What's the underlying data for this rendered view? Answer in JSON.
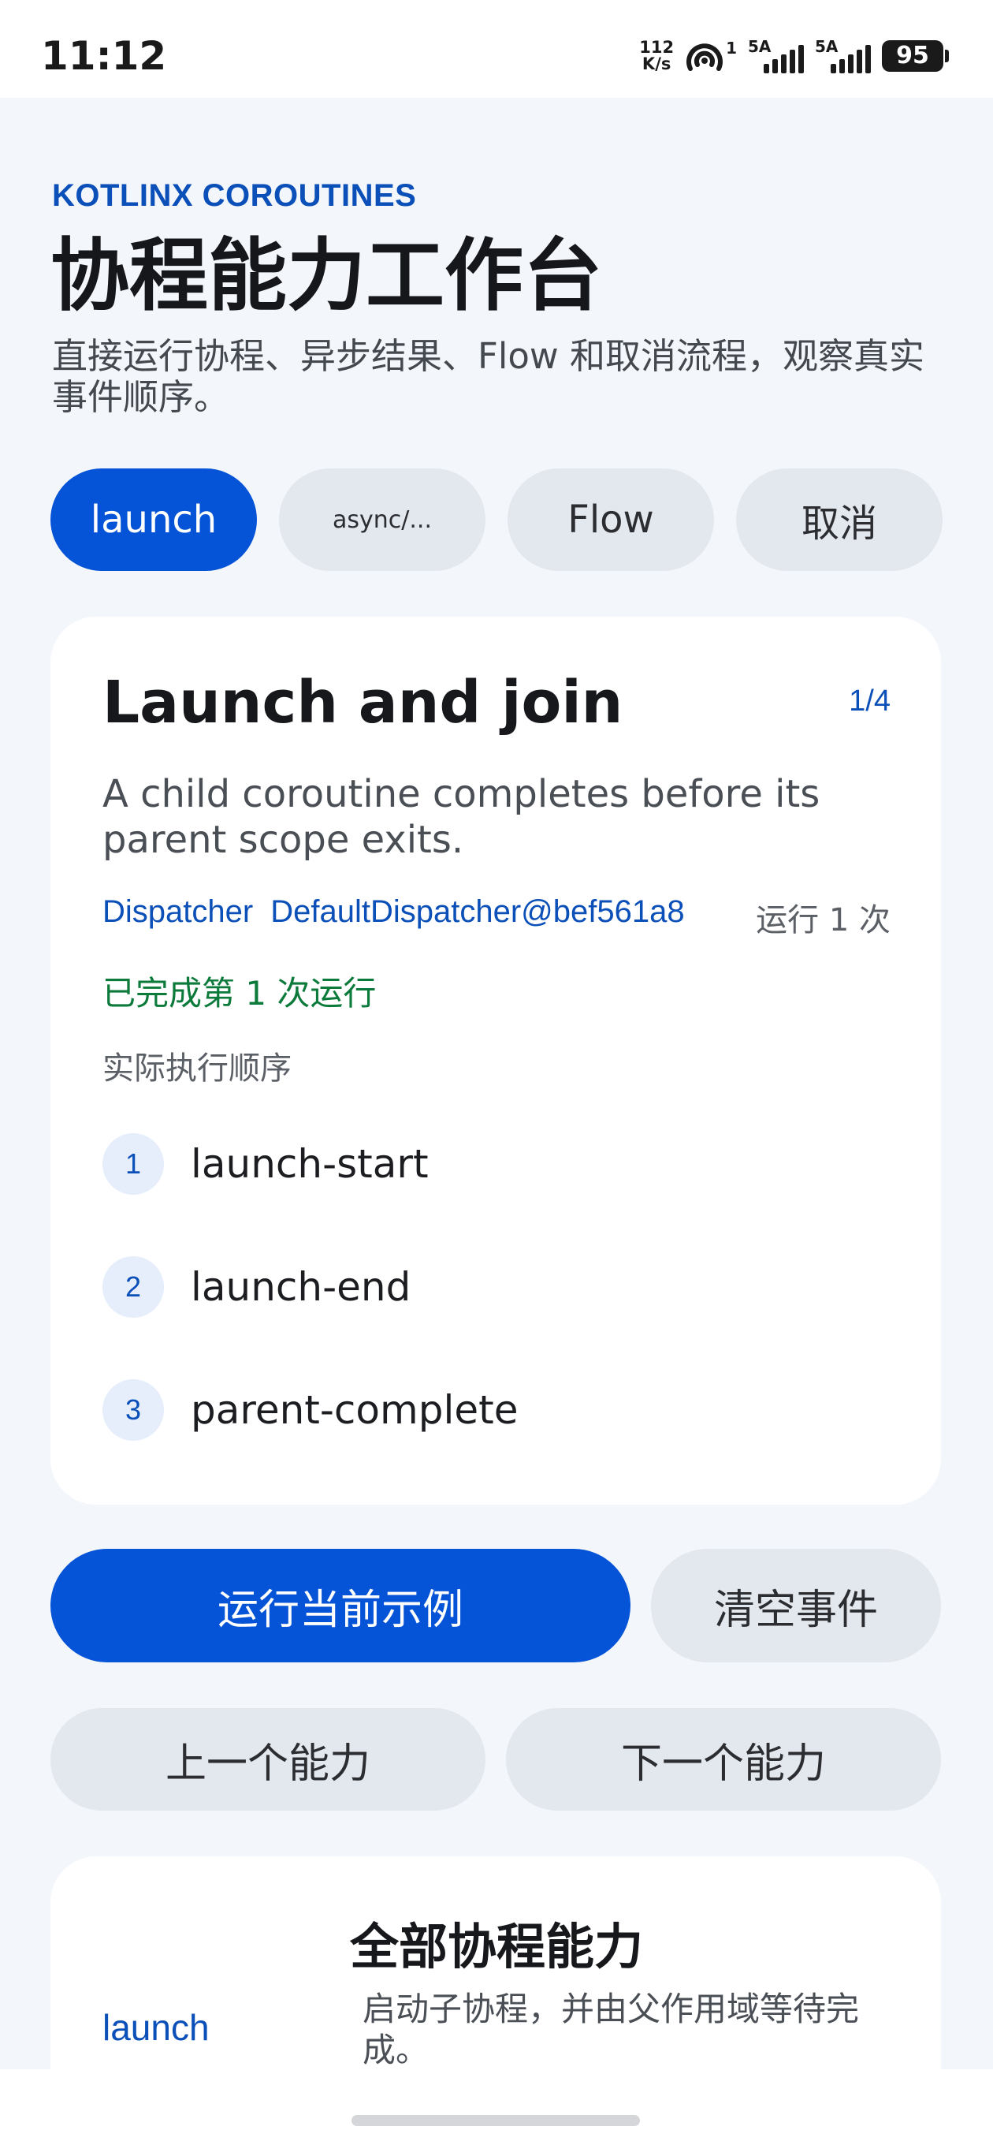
{
  "status_bar": {
    "time": "11:12",
    "net_speed_value": "112",
    "net_speed_unit": "K/s",
    "hotspot_count": "1",
    "sim1_label": "5A",
    "sim2_label": "5A",
    "battery": "95"
  },
  "header": {
    "overline": "KOTLINX COROUTINES",
    "title": "协程能力工作台",
    "subtitle": "直接运行协程、异步结果、Flow 和取消流程，观察真实事件顺序。"
  },
  "tabs": [
    {
      "label": "launch",
      "active": true
    },
    {
      "label": "async/...",
      "active": false
    },
    {
      "label": "Flow",
      "active": false
    },
    {
      "label": "取消",
      "active": false
    }
  ],
  "card": {
    "title": "Launch and join",
    "counter": "1/4",
    "description": "A child coroutine completes before its parent scope exits.",
    "dispatcher_label": "Dispatcher",
    "dispatcher_value": "DefaultDispatcher@bef561a8",
    "run_count": "运行 1 次",
    "run_status": "已完成第 1 次运行",
    "order_label": "实际执行顺序",
    "events": [
      {
        "index": "1",
        "name": "launch-start"
      },
      {
        "index": "2",
        "name": "launch-end"
      },
      {
        "index": "3",
        "name": "parent-complete"
      }
    ]
  },
  "actions": {
    "run": "运行当前示例",
    "clear": "清空事件",
    "prev": "上一个能力",
    "next": "下一个能力"
  },
  "all_capabilities": {
    "title": "全部协程能力",
    "items": [
      {
        "name": "launch",
        "description": "启动子协程，并由父作用域等待完成。"
      }
    ]
  },
  "colors": {
    "accent": "#0553d6",
    "accent_text": "#0b4fb8",
    "success": "#0b7a3a",
    "background": "#f3f6fb"
  }
}
